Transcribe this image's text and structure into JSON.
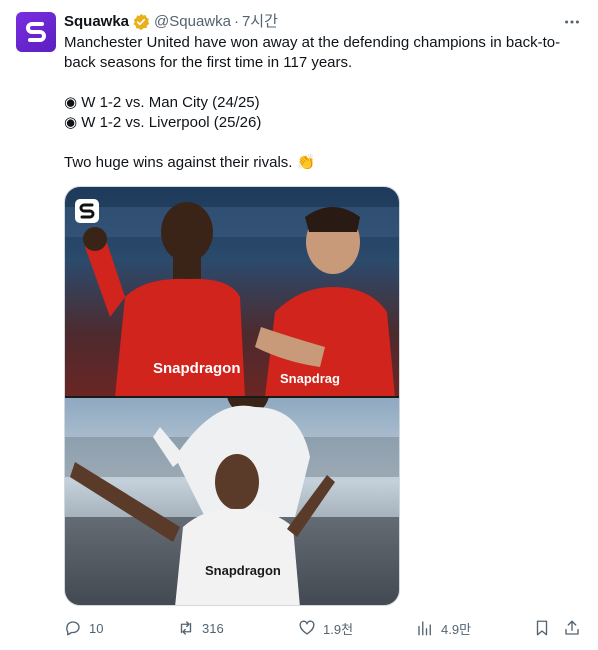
{
  "tweet": {
    "author_name": "Squawka",
    "handle": "@Squawka",
    "separator": "·",
    "time": "7시간",
    "lines": [
      "Manchester United have won away at the defending champions in back-to-",
      "back seasons for the first time in 117 years.",
      "",
      "◉ W 1-2 vs. Man City (24/25)",
      "◉ W 1-2 vs. Liverpool (25/26)",
      "",
      "Two huge wins against their rivals. 👏"
    ],
    "media_alt": "Manchester United players celebrating"
  },
  "actions": {
    "replies": "10",
    "retweets": "316",
    "likes": "1.9천",
    "views": "4.9만"
  },
  "colors": {
    "brand": "#6a24d4",
    "verified": "#e8b01a",
    "muted": "#536471"
  },
  "icons": [
    "more-icon",
    "verified-icon",
    "reply-icon",
    "retweet-icon",
    "like-icon",
    "views-icon",
    "bookmark-icon",
    "share-icon"
  ]
}
